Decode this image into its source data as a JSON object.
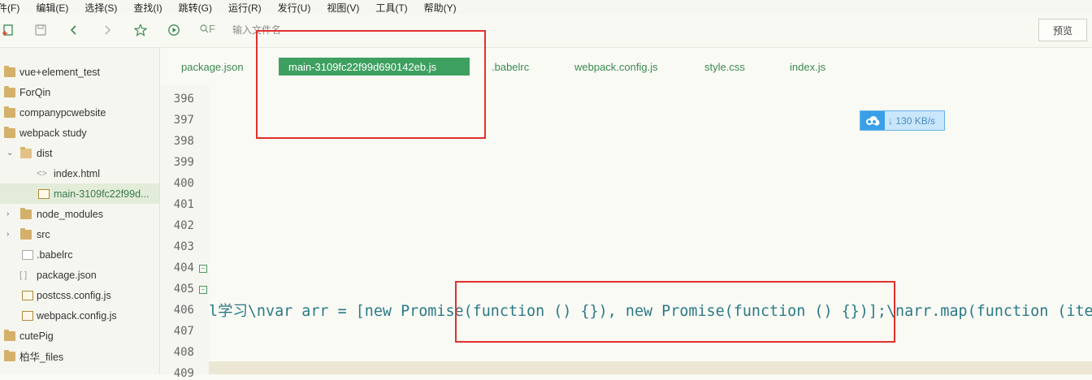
{
  "menu": [
    "件(F)",
    "编辑(E)",
    "选择(S)",
    "查找(I)",
    "跳转(G)",
    "运行(R)",
    "发行(U)",
    "视图(V)",
    "工具(T)",
    "帮助(Y)"
  ],
  "toolbar": {
    "search_prefix": "F",
    "search_placeholder": "输入文件名",
    "preview_label": "预览"
  },
  "sidebar": {
    "items": [
      {
        "label": "vue+element_test",
        "type": "folder"
      },
      {
        "label": "ForQin",
        "type": "folder"
      },
      {
        "label": "companypcwebsite",
        "type": "folder"
      },
      {
        "label": "webpack study",
        "type": "folder"
      },
      {
        "label": "dist",
        "type": "folder-open"
      },
      {
        "label": "index.html",
        "type": "html"
      },
      {
        "label": "main-3109fc22f99d...",
        "type": "file"
      },
      {
        "label": "node_modules",
        "type": "folder"
      },
      {
        "label": "src",
        "type": "folder"
      },
      {
        "label": ".babelrc",
        "type": "file"
      },
      {
        "label": "package.json",
        "type": "json"
      },
      {
        "label": "postcss.config.js",
        "type": "file"
      },
      {
        "label": "webpack.config.js",
        "type": "file"
      },
      {
        "label": "cutePig",
        "type": "folder"
      },
      {
        "label": "柏华_files",
        "type": "folder"
      }
    ]
  },
  "tabs": [
    "package.json",
    "main-3109fc22f99d690142eb.js",
    ".babelrc",
    "webpack.config.js",
    "style.css",
    "index.js"
  ],
  "active_tab": 1,
  "editor": {
    "line_numbers": [
      "396",
      "397",
      "398",
      "399",
      "400",
      "401",
      "402",
      "403",
      "404",
      "405",
      "406",
      "407",
      "408",
      "409"
    ],
    "folded_lines": [
      "404",
      "405"
    ],
    "code_line": "l学习\\nvar arr = [new Promise(function () {}), new Promise(function () {})];\\narr.map(function (ite"
  },
  "download_badge": {
    "speed": "130 KB/s"
  },
  "colors": {
    "accent": "#3ea060",
    "annotation": "#e0312b",
    "code": "#2a7a86"
  }
}
